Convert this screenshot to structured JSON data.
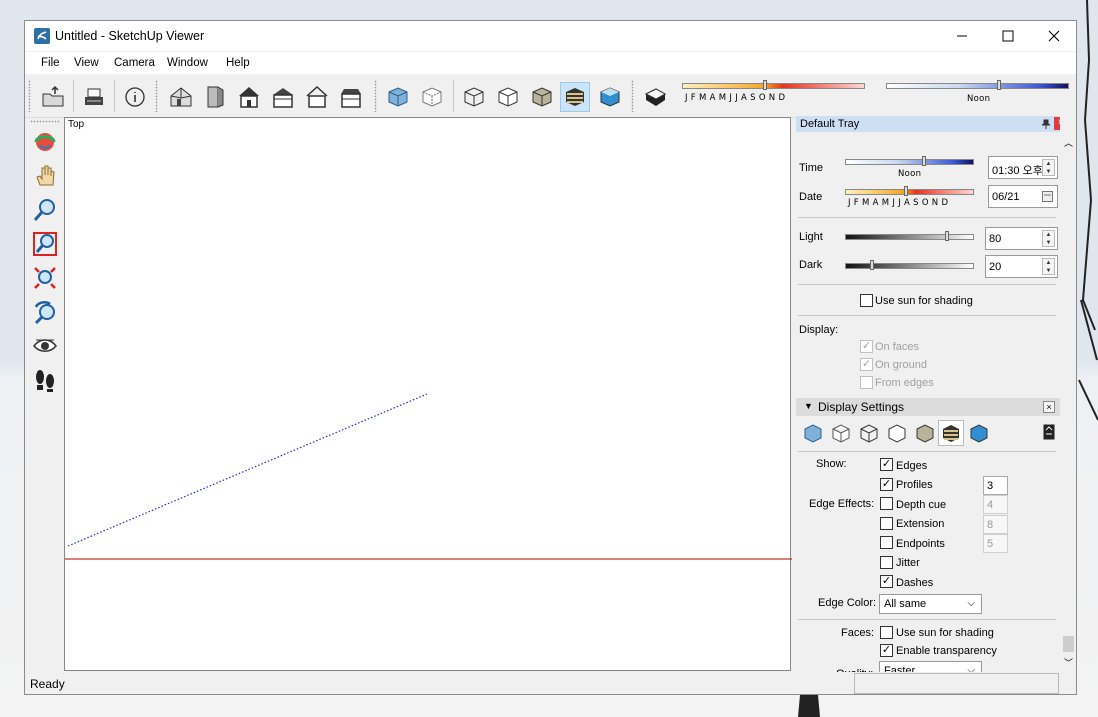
{
  "window": {
    "title": "Untitled - SketchUp Viewer"
  },
  "menu": [
    "File",
    "View",
    "Camera",
    "Window",
    "Help"
  ],
  "toolbar": {
    "months": "J F M A M J J A S O N D",
    "noon": "Noon"
  },
  "viewport": {
    "view_label": "Top"
  },
  "status": {
    "text": "Ready"
  },
  "tray": {
    "title": "Default Tray",
    "time_label": "Time",
    "time_value": "01:30 오후",
    "noon": "Noon",
    "date_label": "Date",
    "date_value": "06/21",
    "months": "J F M A M J J A S O N D",
    "light_label": "Light",
    "light_value": "80",
    "light_level": 0.8,
    "dark_label": "Dark",
    "dark_value": "20",
    "dark_level": 0.2,
    "use_sun_label": "Use sun for shading",
    "display_label": "Display:",
    "on_faces": "On faces",
    "on_ground": "On ground",
    "from_edges": "From edges"
  },
  "display_settings": {
    "title": "Display Settings",
    "show_label": "Show:",
    "edges": "Edges",
    "profiles": "Profiles",
    "profiles_value": "3",
    "edge_effects_label": "Edge Effects:",
    "depth_cue": "Depth cue",
    "depth_cue_value": "4",
    "extension": "Extension",
    "extension_value": "8",
    "endpoints": "Endpoints",
    "endpoints_value": "5",
    "jitter": "Jitter",
    "dashes": "Dashes",
    "edge_color_label": "Edge Color:",
    "edge_color_value": "All same",
    "faces_label": "Faces:",
    "faces_use_sun": "Use sun for shading",
    "enable_transparency": "Enable transparency",
    "quality_label": "Quality:",
    "quality_value": "Faster"
  },
  "colors": {
    "accent": "#3c7fb1",
    "red_axis": "#c0392b",
    "blue_axis": "#1f2fb5"
  }
}
